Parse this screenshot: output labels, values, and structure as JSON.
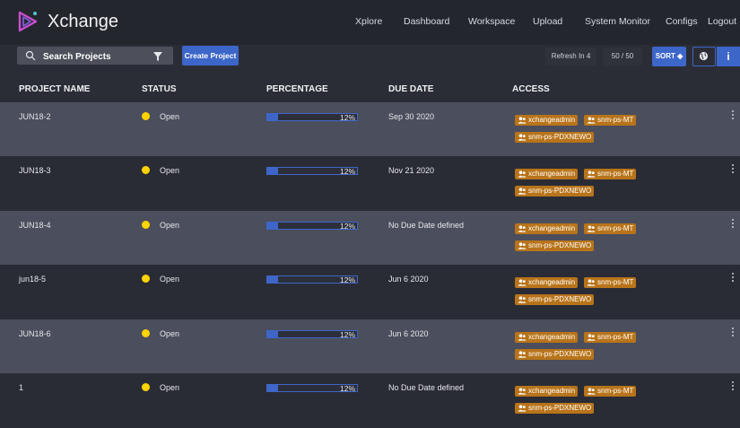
{
  "app": {
    "brand": "Xchange"
  },
  "nav": [
    "Xplore",
    "Dashboard",
    "Workspace",
    "Upload",
    "System Monitor",
    "Configs",
    "Logout"
  ],
  "toolbar": {
    "search_placeholder": "Search Projects",
    "create_label": "Create Project",
    "refresh_label": "Refresh In 4",
    "count_label": "50 / 50",
    "sort_label": "SORT ◆",
    "info_label": "i"
  },
  "columns": [
    "PROJECT NAME",
    "STATUS",
    "PERCENTAGE",
    "DUE DATE",
    "ACCESS"
  ],
  "rows": [
    {
      "name": "JUN18-2",
      "status": "Open",
      "percent_label": "12%",
      "percent": 12,
      "due": "Sep 30 2020",
      "access": [
        "xchangeadmin",
        "snm-ps-MT",
        "snm-ps-PDXNEWO"
      ]
    },
    {
      "name": "JUN18-3",
      "status": "Open",
      "percent_label": "12%",
      "percent": 12,
      "due": "Nov 21 2020",
      "access": [
        "xchangeadmin",
        "snm-ps-MT",
        "snm-ps-PDXNEWO"
      ]
    },
    {
      "name": "JUN18-4",
      "status": "Open",
      "percent_label": "12%",
      "percent": 12,
      "due": "No Due Date defined",
      "access": [
        "xchangeadmin",
        "snm-ps-MT",
        "snm-ps-PDXNEWO"
      ]
    },
    {
      "name": "jun18-5",
      "status": "Open",
      "percent_label": "12%",
      "percent": 12,
      "due": "Jun 6 2020",
      "access": [
        "xchangeadmin",
        "snm-ps-MT",
        "snm-ps-PDXNEWO"
      ]
    },
    {
      "name": "JUN18-6",
      "status": "Open",
      "percent_label": "12%",
      "percent": 12,
      "due": "Jun 6 2020",
      "access": [
        "xchangeadmin",
        "snm-ps-MT",
        "snm-ps-PDXNEWO"
      ]
    },
    {
      "name": "1",
      "status": "Open",
      "percent_label": "12%",
      "percent": 12,
      "due": "No Due Date defined",
      "access": [
        "xchangeadmin",
        "snm-ps-MT",
        "snm-ps-PDXNEWO"
      ]
    }
  ],
  "colors": {
    "accent": "#3d66c9",
    "badge": "#b8741a",
    "status_open": "#ffd400",
    "row_alt": "#4b4e5c",
    "row_dark": "#2a2c35"
  }
}
